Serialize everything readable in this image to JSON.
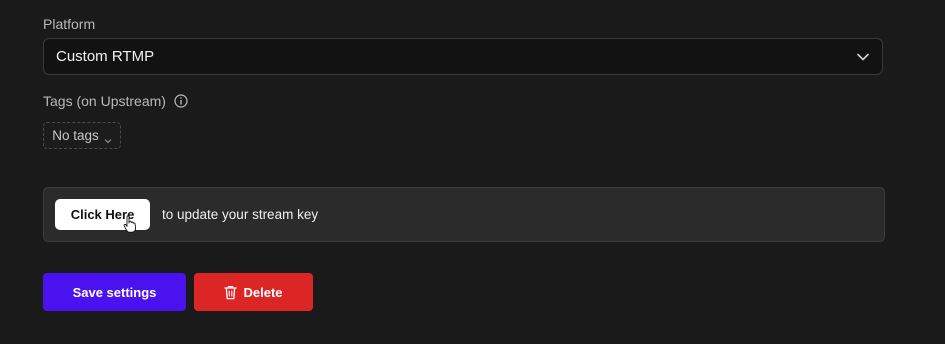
{
  "platform": {
    "label": "Platform",
    "selected": "Custom RTMP"
  },
  "tags": {
    "label": "Tags (on Upstream)",
    "button_label": "No tags"
  },
  "stream_key": {
    "button_label": "Click Here",
    "text": "to update your stream key"
  },
  "actions": {
    "save_label": "Save settings",
    "delete_label": "Delete"
  },
  "icons": {
    "chevron": "chevron-down-icon",
    "info": "info-icon",
    "trash": "trash-icon",
    "cursor": "hand-pointer-icon"
  },
  "colors": {
    "save": "#4a12ef",
    "delete": "#dc2626"
  }
}
